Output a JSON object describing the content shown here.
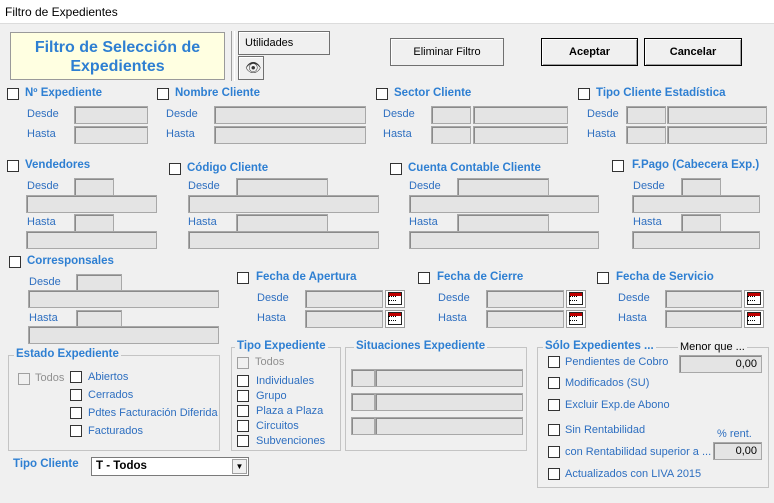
{
  "window": {
    "title": "Filtro de Expedientes"
  },
  "banner": {
    "line1": "Filtro de Selección de",
    "line2": "Expedientes"
  },
  "buttons": {
    "utilidades": "Utilidades",
    "eliminar": "Eliminar Filtro",
    "aceptar": "Aceptar",
    "cancelar": "Cancelar"
  },
  "labels": {
    "desde": "Desde",
    "hasta": "Hasta"
  },
  "sections": {
    "nexp": "Nº Expediente",
    "nombre": "Nombre Cliente",
    "sector": "Sector Cliente",
    "tipoest": "Tipo Cliente Estadística",
    "vendedores": "Vendedores",
    "codigo": "Código Cliente",
    "cuenta": "Cuenta Contable Cliente",
    "fpago": "F.Pago (Cabecera Exp.)",
    "corresponsales": "Corresponsales",
    "apertura": "Fecha de Apertura",
    "cierre": "Fecha de Cierre",
    "servicio": "Fecha de Servicio"
  },
  "estado": {
    "title": "Estado Expediente",
    "todos": "Todos",
    "items": [
      "Abiertos",
      "Cerrados",
      "Pdtes Facturación Diferida",
      "Facturados"
    ]
  },
  "tipo": {
    "title": "Tipo Expediente",
    "todos": "Todos",
    "items": [
      "Individuales",
      "Grupo",
      "Plaza a Plaza",
      "Circuitos",
      "Subvenciones"
    ]
  },
  "situaciones": {
    "title": "Situaciones Expediente"
  },
  "solo": {
    "title": "Sólo Expedientes ...",
    "menor": "Menor que ...",
    "menor_value": "0,00",
    "pct_label": "% rent.",
    "pct_value": "0,00",
    "items": [
      "Pendientes de Cobro",
      "Modificados (SU)",
      "Excluir Exp.de Abono",
      "Sin Rentabilidad",
      "con Rentabilidad superior a ...",
      "Actualizados con LIVA 2015"
    ]
  },
  "tipocliente": {
    "label": "Tipo Cliente",
    "value": "T - Todos"
  }
}
